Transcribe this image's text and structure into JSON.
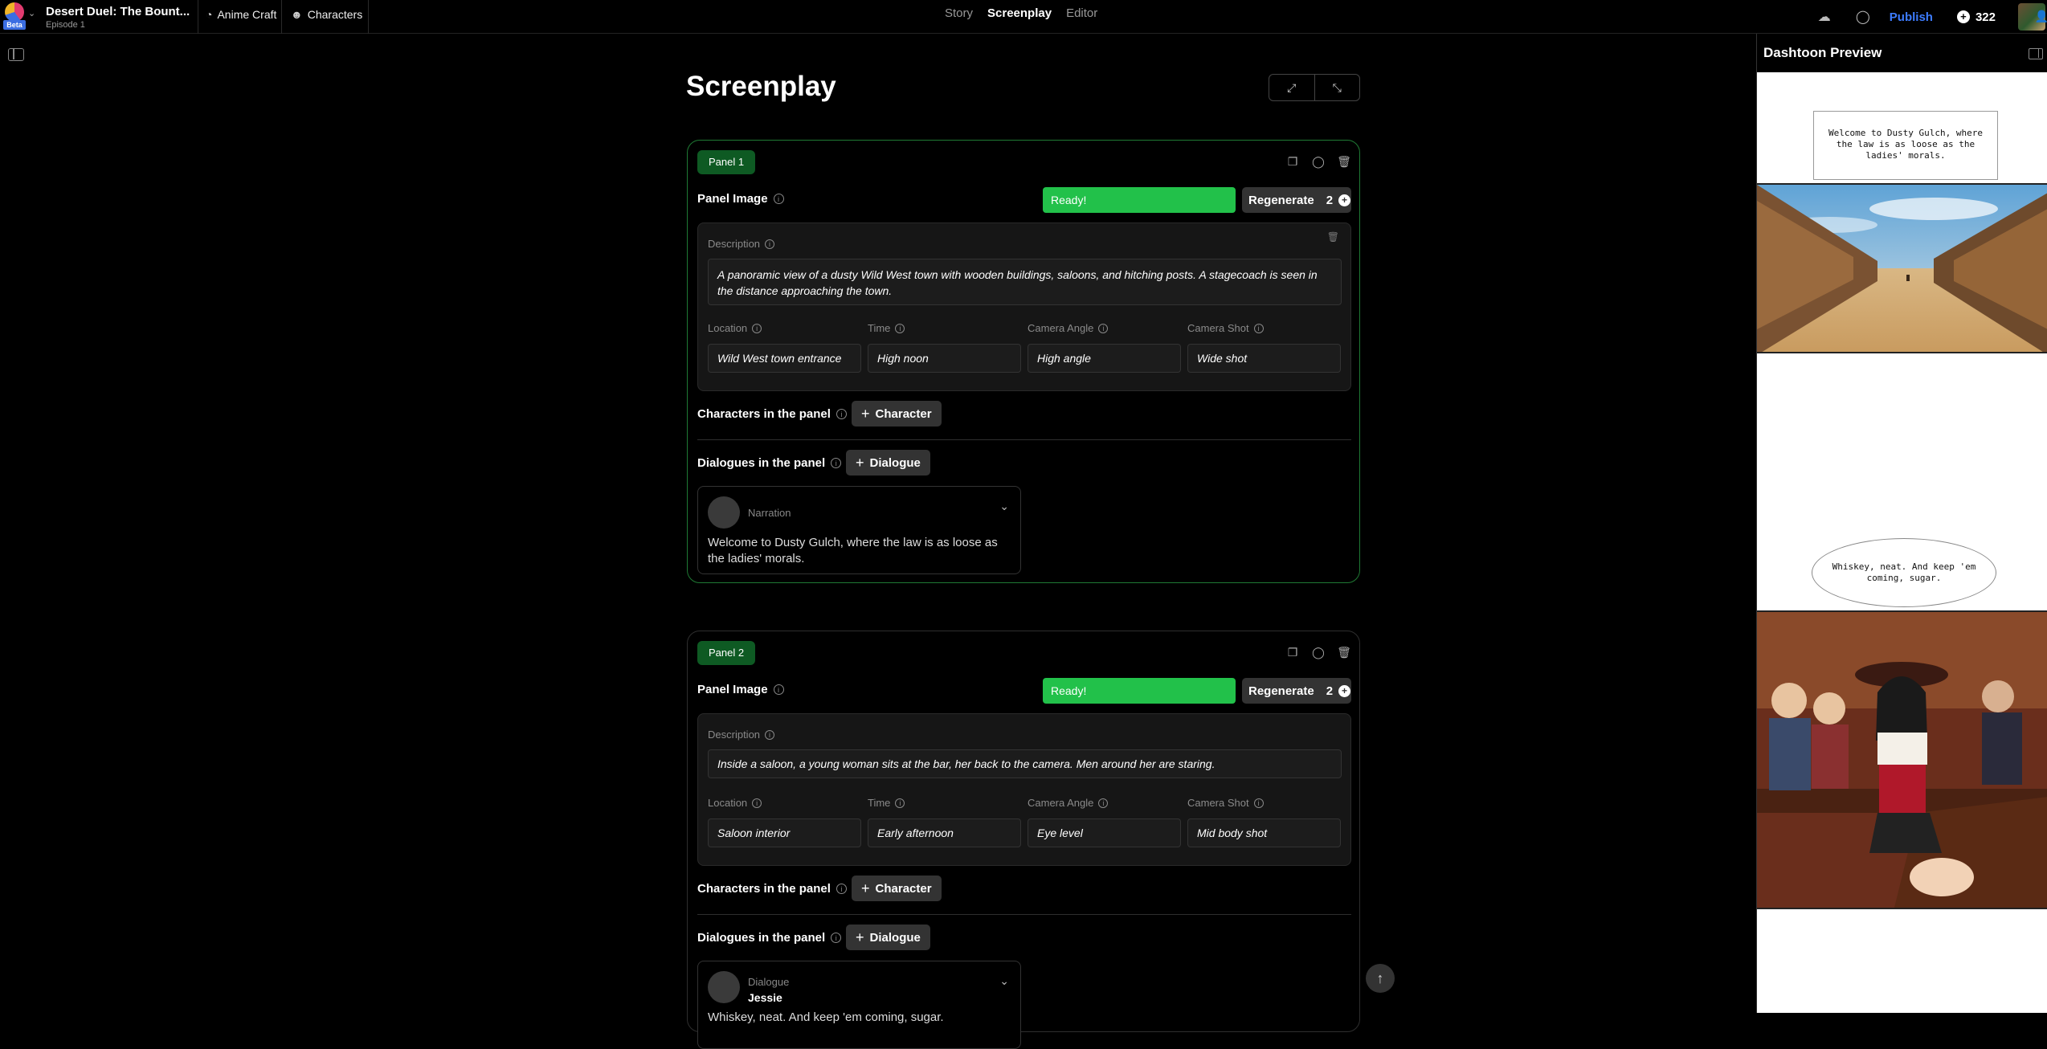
{
  "app": {
    "project_title": "Desert Duel: The Bount...",
    "episode": "Episode 1",
    "beta_label": "Beta",
    "style_chip": "Anime Craft",
    "characters_chip": "Characters"
  },
  "nav": {
    "tabs": [
      "Story",
      "Screenplay",
      "Editor"
    ],
    "active": "Screenplay"
  },
  "topright": {
    "publish": "Publish",
    "credits": "322"
  },
  "main": {
    "title": "Screenplay"
  },
  "labels": {
    "panel_image": "Panel Image",
    "description": "Description",
    "location": "Location",
    "time": "Time",
    "camera_angle": "Camera Angle",
    "camera_shot": "Camera Shot",
    "characters": "Characters in the panel",
    "dialogues": "Dialogues in the panel",
    "add_character": "Character",
    "add_dialogue": "Dialogue",
    "ready": "Ready!",
    "regenerate": "Regenerate",
    "regen_cost": "2"
  },
  "panels": [
    {
      "badge": "Panel 1",
      "description": "A panoramic view of a dusty Wild West town with wooden buildings, saloons, and hitching posts. A stagecoach is seen in the distance approaching the town.",
      "location": "Wild West town entrance",
      "time": "High noon",
      "camera_angle": "High angle",
      "camera_shot": "Wide shot",
      "dialogue": {
        "type": "Narration",
        "speaker": "",
        "text": "Welcome to Dusty Gulch, where the law is as loose as the ladies' morals."
      }
    },
    {
      "badge": "Panel 2",
      "description": "Inside a saloon, a young woman sits at the bar, her back to the camera. Men around her are staring.",
      "location": "Saloon interior",
      "time": "Early afternoon",
      "camera_angle": "Eye level",
      "camera_shot": "Mid body shot",
      "dialogue": {
        "type": "Dialogue",
        "speaker": "Jessie",
        "text": "Whiskey, neat. And keep 'em coming, sugar."
      }
    }
  ],
  "preview": {
    "title": "Dashtoon Preview",
    "bubble1": "Welcome to Dusty Gulch, where the law is as loose as the ladies' morals.",
    "bubble2": "Whiskey, neat. And keep 'em coming, sugar."
  },
  "colors": {
    "accent_green": "#22c14a",
    "panel_badge": "#0e5a23",
    "publish_blue": "#3d7cff"
  }
}
